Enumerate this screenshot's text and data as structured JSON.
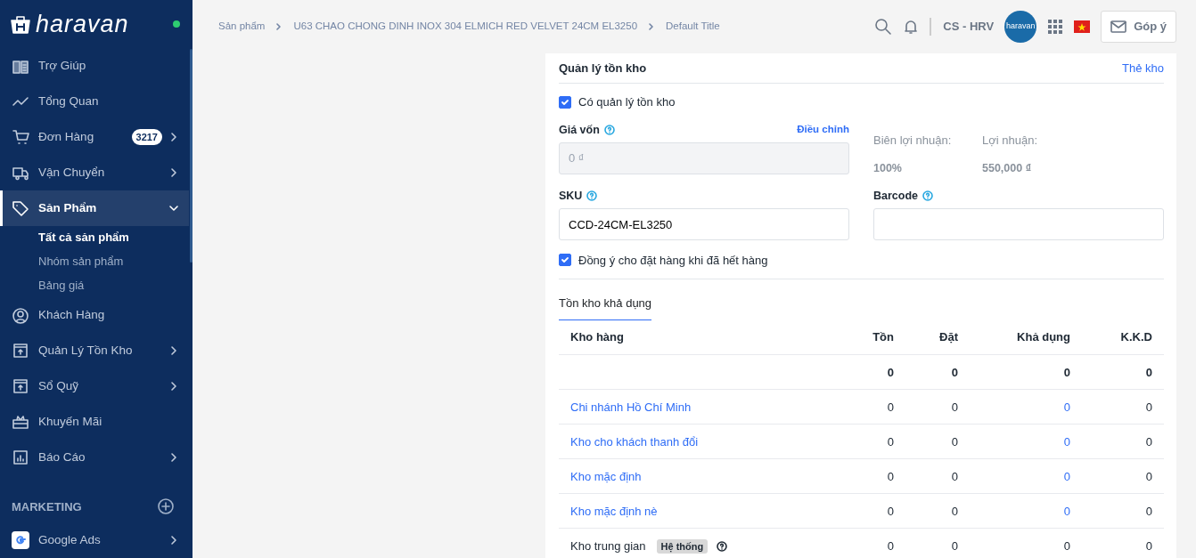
{
  "sidebar": {
    "logo_text": "haravan",
    "online": true,
    "items": [
      {
        "label": "Trợ Giúp",
        "selected": false
      },
      {
        "label": "Tổng Quan",
        "selected": false
      },
      {
        "label": "Đơn Hàng",
        "badge": "3217",
        "expanded": false,
        "selected": false
      },
      {
        "label": "Vận Chuyển",
        "expanded": false,
        "selected": false
      },
      {
        "label": "Sản Phẩm",
        "expanded": true,
        "selected": true,
        "children": [
          {
            "label": "Tất cả sản phẩm",
            "selected": true
          },
          {
            "label": "Nhóm sản phẩm",
            "selected": false
          },
          {
            "label": "Bảng giá",
            "selected": false
          }
        ]
      },
      {
        "label": "Khách Hàng",
        "selected": false
      },
      {
        "label": "Quản Lý Tồn Kho",
        "expanded": false,
        "selected": false
      },
      {
        "label": "Sổ Quỹ",
        "expanded": false,
        "selected": false
      },
      {
        "label": "Khuyến Mãi",
        "selected": false
      },
      {
        "label": "Báo Cáo",
        "expanded": false,
        "selected": false
      }
    ],
    "section": "MARKETING",
    "apps": [
      {
        "label": "Google Ads",
        "expanded": false
      }
    ]
  },
  "header": {
    "breadcrumb": [
      "Sản phẩm",
      "U63 CHAO CHONG DINH INOX 304 ELMICH RED VELVET 24CM EL3250",
      "Default Title"
    ],
    "account": "CS - HRV",
    "avatar_text": "haravan",
    "feedback": "Góp ý"
  },
  "inventory": {
    "title": "Quản lý tồn kho",
    "link": "Thẻ kho",
    "track": {
      "label": "Có quản lý tồn kho",
      "checked": true
    },
    "cost": {
      "label": "Giá vốn",
      "action": "Điều chỉnh",
      "value": "0 ₫",
      "disabled": true
    },
    "margin": {
      "label": "Biên lợi nhuận:",
      "value": "100%"
    },
    "profit": {
      "label": "Lợi nhuận:",
      "value": "550,000 ₫"
    },
    "sku": {
      "label": "SKU",
      "value": "CCD-24CM-EL3250"
    },
    "barcode": {
      "label": "Barcode"
    },
    "oversell": {
      "label": "Đồng ý cho đặt hàng khi đã hết hàng",
      "checked": true
    },
    "tab": "Tồn kho khả dụng",
    "columns": [
      "Kho hàng",
      "Tồn",
      "Đặt",
      "Khả dụng",
      "K.K.D"
    ],
    "rows": [
      {
        "kind": "summary",
        "values": [
          "0",
          "0",
          "0",
          "0"
        ]
      },
      {
        "kind": "link",
        "name": "Chi nhánh Hồ Chí Minh",
        "values": [
          "0",
          "0",
          "0",
          "0"
        ]
      },
      {
        "kind": "link",
        "name": "Kho cho khách thanh đổi",
        "values": [
          "0",
          "0",
          "0",
          "0"
        ]
      },
      {
        "kind": "link",
        "name": "Kho mặc định",
        "values": [
          "0",
          "0",
          "0",
          "0"
        ]
      },
      {
        "kind": "link",
        "name": "Kho mặc định nè",
        "values": [
          "0",
          "0",
          "0",
          "0"
        ]
      },
      {
        "kind": "system",
        "name": "Kho trung gian",
        "tag": "Hệ thống",
        "values": [
          "0",
          "0",
          "0",
          "0"
        ]
      }
    ]
  }
}
